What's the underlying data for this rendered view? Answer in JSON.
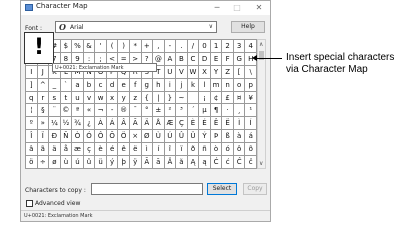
{
  "window": {
    "title": "Character Map",
    "controls": {
      "minimize": "─",
      "maximize": "□",
      "close": "✕"
    }
  },
  "font_row": {
    "label": "Font :",
    "glyph": "O",
    "value": "Arial",
    "chevron": "∨",
    "help_label": "Help"
  },
  "grid": {
    "rows": [
      [
        "!",
        "\"",
        "#",
        "$",
        "%",
        "&",
        "'",
        "(",
        ")",
        "*",
        "+",
        ",",
        "-",
        ".",
        "/",
        "0",
        "1",
        "2",
        "3",
        "4"
      ],
      [
        "5",
        "6",
        "7",
        "8",
        "9",
        ":",
        ";",
        "<",
        "=",
        ">",
        "?",
        "@",
        "A",
        "B",
        "C",
        "D",
        "E",
        "F",
        "G",
        "H"
      ],
      [
        "I",
        "J",
        "K",
        "L",
        "M",
        "N",
        "O",
        "P",
        "Q",
        "R",
        "S",
        "T",
        "U",
        "V",
        "W",
        "X",
        "Y",
        "Z",
        "[",
        "\\"
      ],
      [
        "]",
        "^",
        "_",
        "`",
        "a",
        "b",
        "c",
        "d",
        "e",
        "f",
        "g",
        "h",
        "i",
        "j",
        "k",
        "l",
        "m",
        "n",
        "o",
        "p"
      ],
      [
        "q",
        "r",
        "s",
        "t",
        "u",
        "v",
        "w",
        "x",
        "y",
        "z",
        "{",
        "|",
        "}",
        "~",
        " ",
        "¡",
        "¢",
        "£",
        "¤",
        "¥"
      ],
      [
        "¦",
        "§",
        "¨",
        "©",
        "ª",
        "«",
        "¬",
        "-",
        "®",
        "¯",
        "°",
        "±",
        "²",
        "³",
        "´",
        "µ",
        "¶",
        "·",
        "¸",
        "¹"
      ],
      [
        "º",
        "»",
        "¼",
        "½",
        "¾",
        "¿",
        "À",
        "Á",
        "Â",
        "Ã",
        "Ä",
        "Å",
        "Æ",
        "Ç",
        "È",
        "É",
        "Ê",
        "Ë",
        "Ì",
        "Í"
      ],
      [
        "Î",
        "Ï",
        "Ð",
        "Ñ",
        "Ò",
        "Ó",
        "Ô",
        "Õ",
        "Ö",
        "×",
        "Ø",
        "Ù",
        "Ú",
        "Û",
        "Ü",
        "Ý",
        "Þ",
        "ß",
        "à",
        "á"
      ],
      [
        "â",
        "ã",
        "ä",
        "å",
        "æ",
        "ç",
        "è",
        "é",
        "ê",
        "ë",
        "ì",
        "í",
        "î",
        "ï",
        "ð",
        "ñ",
        "ò",
        "ó",
        "ô",
        "õ"
      ],
      [
        "ö",
        "÷",
        "ø",
        "ù",
        "ú",
        "û",
        "ü",
        "ý",
        "þ",
        "ÿ",
        "Ā",
        "ā",
        "Ă",
        "ă",
        "Ą",
        "ą",
        "Ć",
        "ć",
        "Ĉ",
        "ĉ"
      ]
    ],
    "scroll_up": "∧",
    "scroll_down": "∨"
  },
  "zoom_char": "!",
  "tooltip": "U+0021: Exclamation Mark",
  "copy_row": {
    "label": "Characters to copy :",
    "value": "",
    "select_label": "Select",
    "copy_label": "Copy"
  },
  "advanced_view_label": "Advanced view",
  "status_text": "U+0021: Exclamation Mark",
  "callout": {
    "text": "Insert special characters via Character Map"
  },
  "colors": {
    "accent_border": "#0078d7",
    "window_bg": "#f0f0f0"
  }
}
